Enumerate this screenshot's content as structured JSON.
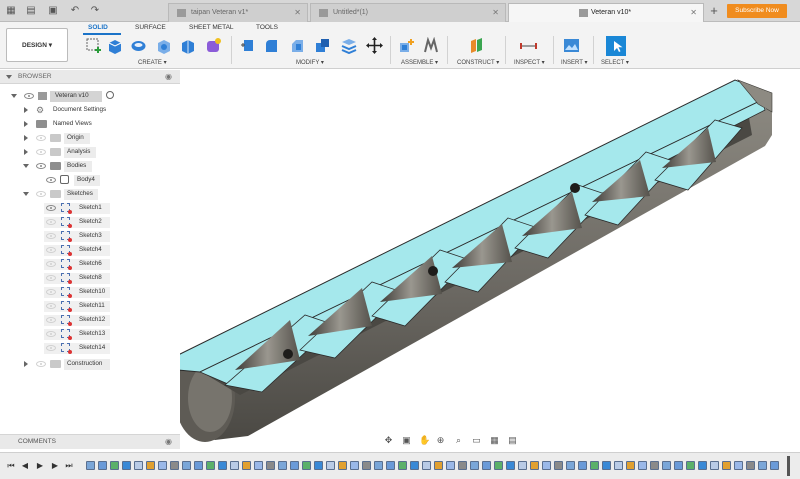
{
  "tabs": {
    "items": [
      {
        "label": "taipan Veteran v1*"
      },
      {
        "label": "Untitled*(1)"
      },
      {
        "label": "Veteran v10*"
      }
    ],
    "subscribe_label": "Subscribe Now"
  },
  "toolbar": {
    "design_label": "DESIGN",
    "workspace_tabs": [
      "SOLID",
      "SURFACE",
      "SHEET METAL",
      "TOOLS"
    ],
    "groups": [
      "CREATE",
      "MODIFY",
      "ASSEMBLE",
      "CONSTRUCT",
      "INSPECT",
      "INSERT",
      "SELECT"
    ]
  },
  "browser": {
    "title": "BROWSER",
    "root": "Veteran v10",
    "items": [
      {
        "label": "Document Settings",
        "icon": "gear-icon"
      },
      {
        "label": "Named Views",
        "icon": "folder-icon"
      },
      {
        "label": "Origin",
        "icon": "folder-icon"
      },
      {
        "label": "Analysis",
        "icon": "folder-icon"
      },
      {
        "label": "Bodies",
        "icon": "folder-icon"
      },
      {
        "label": "Body4",
        "icon": "body-icon"
      },
      {
        "label": "Sketches",
        "icon": "folder-icon"
      },
      {
        "label": "Construction",
        "icon": "folder-icon"
      }
    ],
    "sketches": [
      "Sketch1",
      "Sketch2",
      "Sketch3",
      "Sketch4",
      "Sketch6",
      "Sketch8",
      "Sketch10",
      "Sketch11",
      "Sketch12",
      "Sketch13",
      "Sketch14"
    ]
  },
  "comments": {
    "label": "COMMENTS"
  },
  "colors": {
    "accent": "#1a73c8",
    "subscribe": "#f08c1e",
    "section_face": "#a5e8ec",
    "metal": "#6b6862"
  }
}
